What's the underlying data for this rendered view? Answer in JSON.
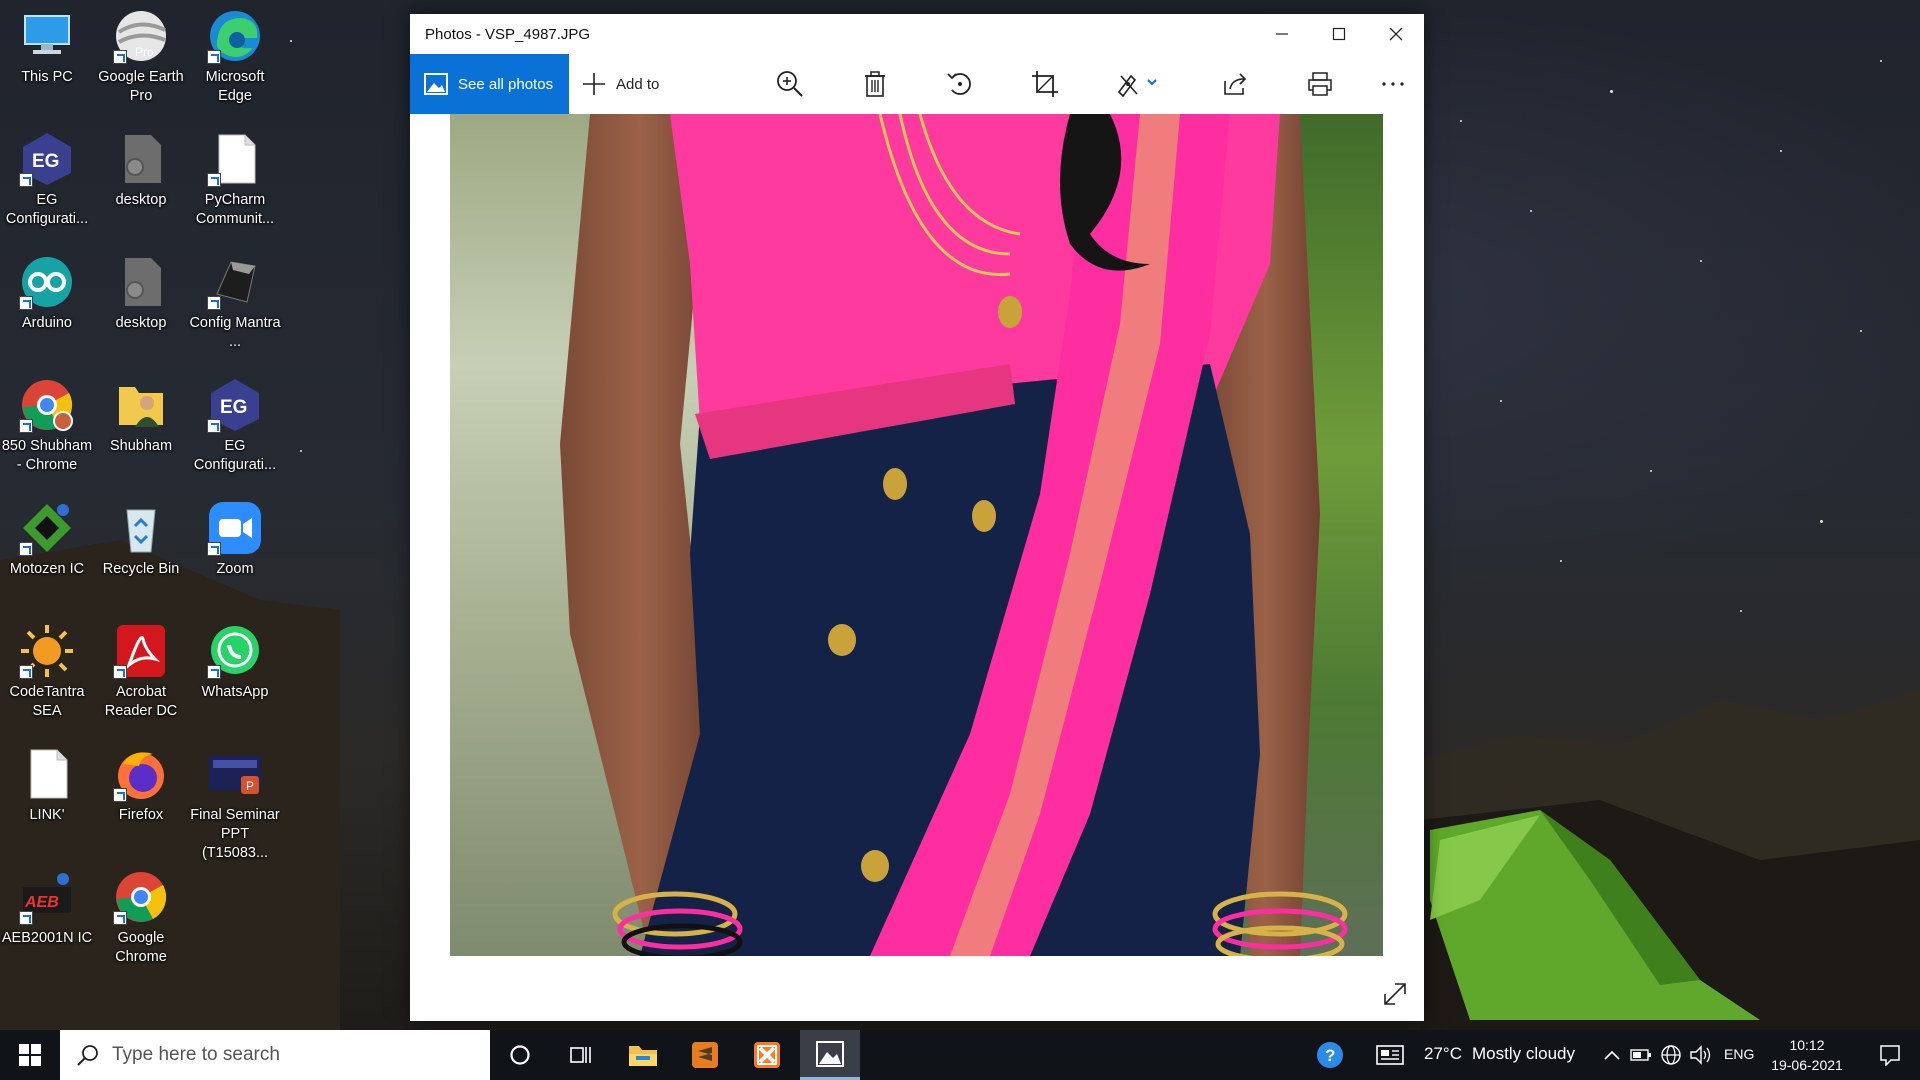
{
  "desktop": {
    "icons": [
      {
        "label": "This PC",
        "icon": "computer-icon"
      },
      {
        "label": "Google Earth Pro",
        "icon": "google-earth-icon",
        "badge": "Pro"
      },
      {
        "label": "Microsoft Edge",
        "icon": "edge-icon"
      },
      {
        "label": "EG Configurati...",
        "icon": "eg-config-icon",
        "logo": "EG"
      },
      {
        "label": "desktop",
        "icon": "gear-file-icon"
      },
      {
        "label": "PyCharm Communit...",
        "icon": "blank-file-icon"
      },
      {
        "label": "Arduino",
        "icon": "arduino-icon"
      },
      {
        "label": "desktop",
        "icon": "gear-file-icon"
      },
      {
        "label": "Config Mantra ...",
        "icon": "config-mantra-icon"
      },
      {
        "label": "850 Shubham - Chrome",
        "icon": "chrome-profile-icon"
      },
      {
        "label": "Shubham",
        "icon": "user-folder-icon"
      },
      {
        "label": "EG Configurati...",
        "icon": "eg-config-icon",
        "logo": "EG"
      },
      {
        "label": "Motozen IC",
        "icon": "motozen-icon"
      },
      {
        "label": "Recycle Bin",
        "icon": "recycle-bin-icon"
      },
      {
        "label": "Zoom",
        "icon": "zoom-icon"
      },
      {
        "label": "CodeTantra SEA",
        "icon": "codetantra-icon"
      },
      {
        "label": "Acrobat Reader DC",
        "icon": "acrobat-icon"
      },
      {
        "label": "WhatsApp",
        "icon": "whatsapp-icon"
      },
      {
        "label": "LINK'",
        "icon": "blank-file-icon"
      },
      {
        "label": "Firefox",
        "icon": "firefox-icon"
      },
      {
        "label": "Final Seminar PPT (T15083...",
        "icon": "powerpoint-file-icon",
        "logo": "P"
      },
      {
        "label": "AEB2001N IC",
        "icon": "aeb-ic-icon",
        "logo": "AEB"
      },
      {
        "label": "Google Chrome",
        "icon": "chrome-icon"
      }
    ]
  },
  "window": {
    "title": "Photos - VSP_4987.JPG",
    "controls": {
      "minimize": "minimize-icon",
      "maximize": "maximize-icon",
      "close": "close-icon"
    },
    "toolbar": {
      "see_all_photos": "See all photos",
      "add_to": "Add to",
      "tools": [
        "zoom-in-icon",
        "delete-icon",
        "rotate-icon",
        "crop-icon",
        "edit-draw-icon",
        "share-icon",
        "print-icon",
        "more-icon"
      ]
    },
    "photo": {
      "description_icon": "photo-content"
    }
  },
  "taskbar": {
    "search_placeholder": "Type here to search",
    "apps": [
      "cortana-icon",
      "task-view-icon",
      "file-explorer-icon",
      "sublime-text-icon",
      "xampp-icon",
      "photos-icon"
    ],
    "active_app": "photos-icon",
    "weather": {
      "temperature": "27°C",
      "condition": "Mostly cloudy"
    },
    "language": "ENG",
    "clock": {
      "time": "10:12",
      "date": "19-06-2021"
    }
  },
  "colors": {
    "accent": "#0a72d6",
    "saree_pink": "#ff2ea0",
    "saree_navy": "#152247",
    "gold": "#c9a23a"
  }
}
